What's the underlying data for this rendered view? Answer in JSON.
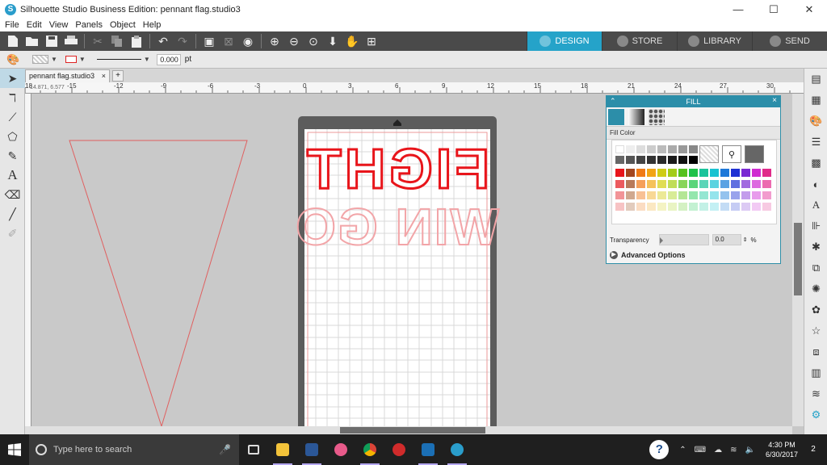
{
  "window": {
    "title": "Silhouette Studio Business Edition: pennant flag.studio3",
    "minimize": "—",
    "maximize": "☐",
    "close": "✕"
  },
  "menu": [
    "File",
    "Edit",
    "View",
    "Panels",
    "Object",
    "Help"
  ],
  "modes": [
    {
      "label": "DESIGN",
      "active": true
    },
    {
      "label": "STORE",
      "active": false
    },
    {
      "label": "LIBRARY",
      "active": false
    },
    {
      "label": "SEND",
      "active": false
    }
  ],
  "properties": {
    "line_weight": "0.000",
    "unit": "pt"
  },
  "document": {
    "tab_label": "pennant flag.studio3",
    "tab_close": "×",
    "add_tab": "+",
    "coords": "14.871, 6.577"
  },
  "ruler_ticks": [
    "18",
    "-15",
    "-12",
    "-9",
    "-6",
    "-3",
    "0",
    "3",
    "6",
    "9",
    "12",
    "15",
    "18",
    "21",
    "24",
    "27",
    "30"
  ],
  "design_text": {
    "line1": "FIGHT",
    "line2": "WIN GO"
  },
  "fill_panel": {
    "title": "FILL",
    "section_label": "Fill Color",
    "transparency_label": "Transparency",
    "transparency_value": "0.0",
    "transparency_unit": "%",
    "advanced_label": "Advanced Options",
    "palette_rows": [
      [
        "#ffffff",
        "#eeeeee",
        "#dddddd",
        "#cccccc",
        "#bbbbbb",
        "#aaaaaa",
        "#999999",
        "#888888"
      ],
      [
        "#666666",
        "#555555",
        "#444444",
        "#333333",
        "#2a2a2a",
        "#1a1a1a",
        "#111111",
        "#000000"
      ],
      [
        "#e8151b",
        "#a3461f",
        "#f07a16",
        "#f2a415",
        "#cfcc16",
        "#a3cc19",
        "#55c11f",
        "#1ec24a",
        "#19c39b",
        "#19c2d1",
        "#1d78d8",
        "#1f31d3",
        "#7a29d3",
        "#cf2bd1",
        "#e02a8a"
      ],
      [
        "#ec5a5e",
        "#b87a5a",
        "#f5a05a",
        "#f5c25a",
        "#e0dd55",
        "#c0dd58",
        "#88d55a",
        "#5ad57a",
        "#5ad5b8",
        "#5ad3e0",
        "#5aa2e3",
        "#6170e0",
        "#a26ae0",
        "#dd6ae0",
        "#ec6ab0"
      ],
      [
        "#f29497",
        "#d0a88f",
        "#f8c195",
        "#f8d895",
        "#ece996",
        "#d8ec97",
        "#b4e696",
        "#94e6ad",
        "#94e6d2",
        "#94e4ec",
        "#94c3ee",
        "#9aa3ec",
        "#c39cec",
        "#e89cec",
        "#f29cce"
      ],
      [
        "#f7c3c4",
        "#e2cbbd",
        "#fbdcc2",
        "#fbe8c2",
        "#f4f3c3",
        "#e9f4c3",
        "#d4f1c3",
        "#c3f1d2",
        "#c3f1e6",
        "#c3f0f4",
        "#c3dcf5",
        "#c6ccf4",
        "#dccaf4",
        "#f2caf4",
        "#f7cae2"
      ]
    ]
  },
  "taskbar": {
    "search_placeholder": "Type here to search",
    "time": "4:30 PM",
    "date": "6/30/2017",
    "notifications": "2",
    "help": "?"
  },
  "colors": {
    "accent": "#25a3c9",
    "cut_line": "#e8151b"
  }
}
